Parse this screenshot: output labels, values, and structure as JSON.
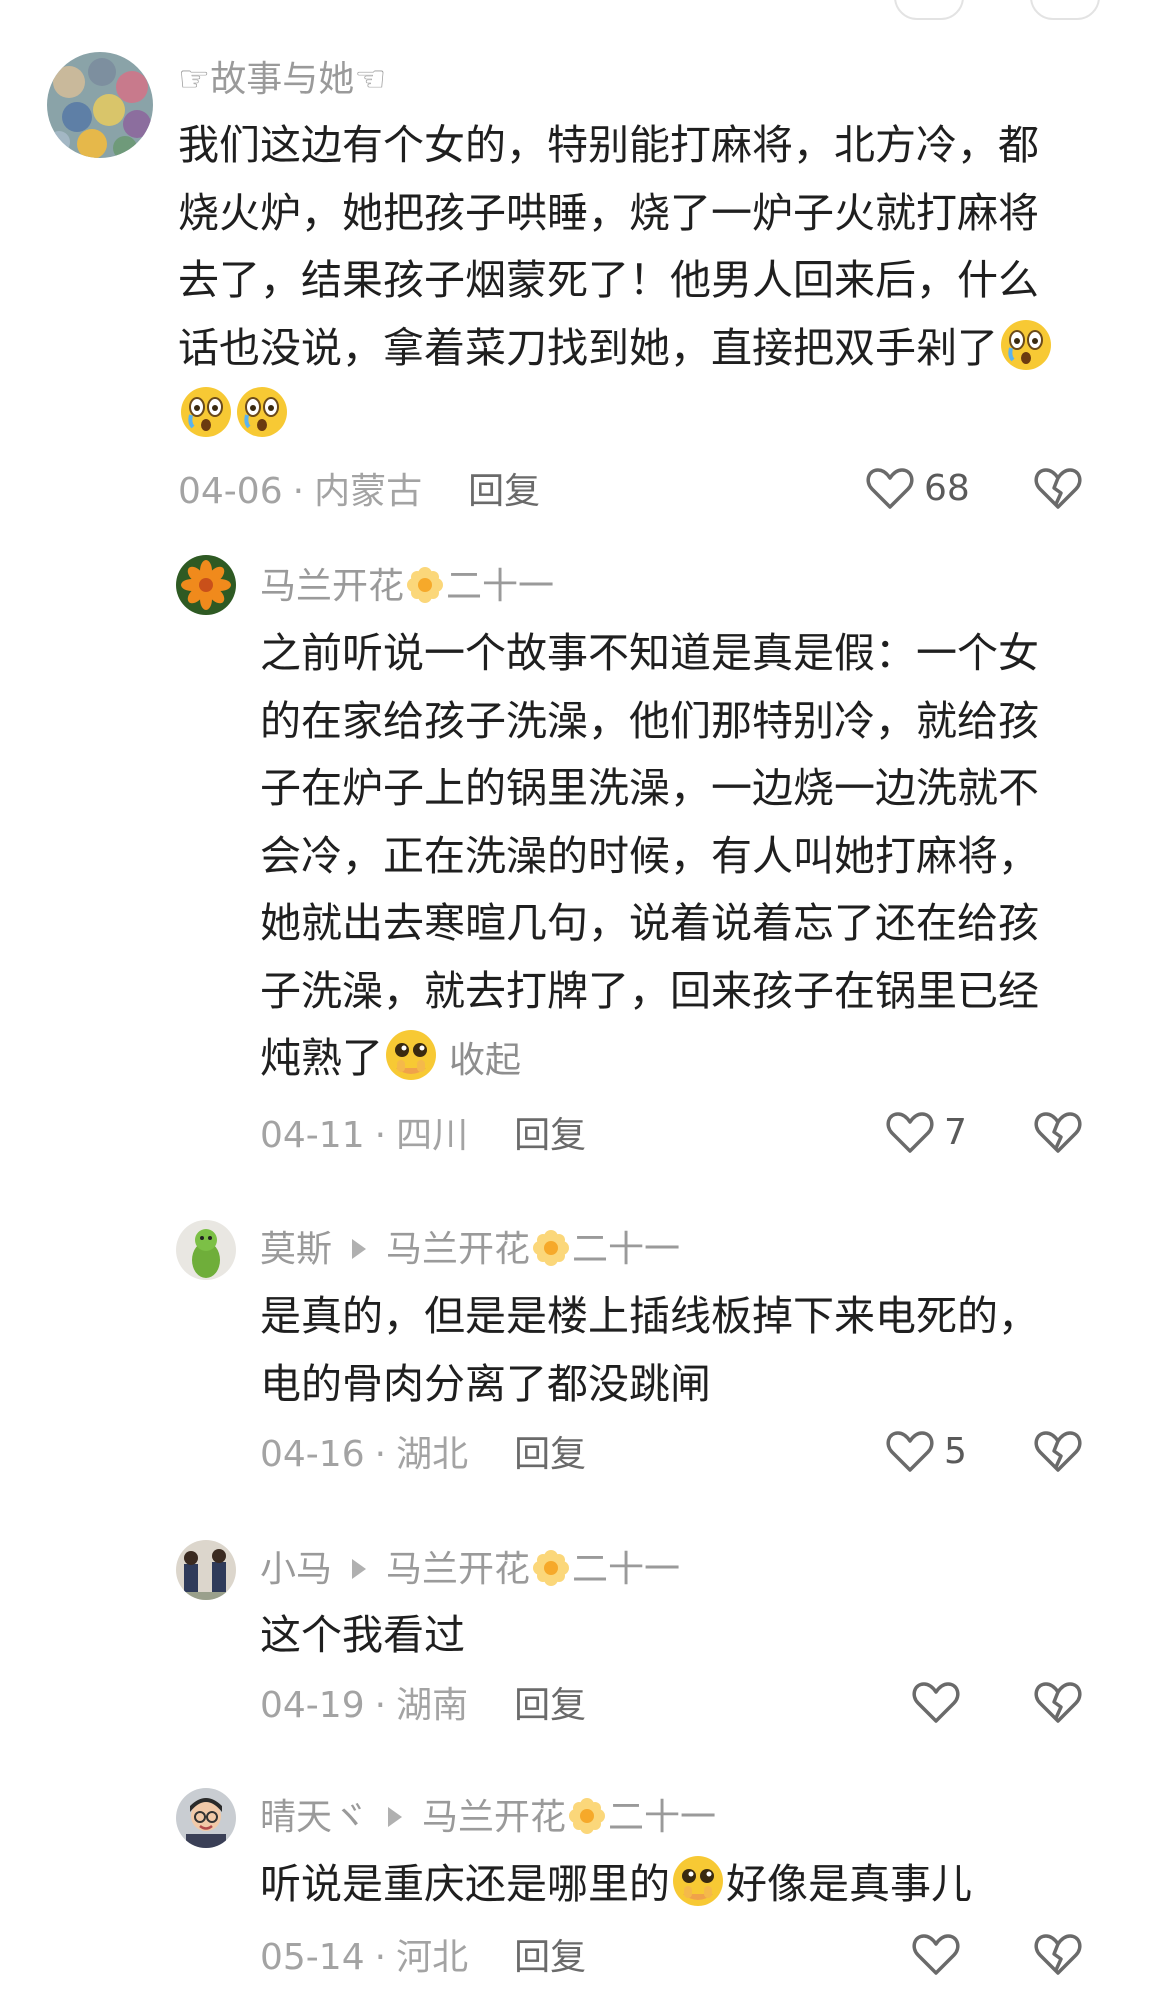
{
  "comments": [
    {
      "username": "☞故事与她☜",
      "text": "我们这边有个女的，特别能打麻将，北方冷，都烧火炉，她把孩子哄睡，烧了一炉子火就打麻将去了，结果孩子烟蒙死了！他男人回来后，什么话也没说，拿着菜刀找到她，直接把双手剁了",
      "date": "04-06",
      "location": "内蒙古",
      "reply_label": "回复",
      "likes": "68"
    },
    {
      "username": "马兰开花",
      "user_suffix": "二十一",
      "text": "之前听说一个故事不知道是真是假：一个女的在家给孩子洗澡，他们那特别冷，就给孩子在炉子上的锅里洗澡，一边烧一边洗就不会冷，正在洗澡的时候，有人叫她打麻将，她就出去寒暄几句，说着说着忘了还在给孩子洗澡，就去打牌了，回来孩子在锅里已经炖熟了",
      "collapse_label": "收起",
      "date": "04-11",
      "location": "四川",
      "reply_label": "回复",
      "likes": "7"
    },
    {
      "username": "莫斯",
      "reply_to": "马兰开花",
      "reply_to_suffix": "二十一",
      "text": "是真的，但是是楼上插线板掉下来电死的，电的骨肉分离了都没跳闸",
      "date": "04-16",
      "location": "湖北",
      "reply_label": "回复",
      "likes": "5"
    },
    {
      "username": "小马",
      "reply_to": "马兰开花",
      "reply_to_suffix": "二十一",
      "text": "这个我看过",
      "date": "04-19",
      "location": "湖南",
      "reply_label": "回复",
      "likes": ""
    },
    {
      "username": "晴天ヾ",
      "reply_to": "马兰开花",
      "reply_to_suffix": "二十一",
      "text_before_emoji": "听说是重庆还是哪里的",
      "text_after_emoji": "好像是真事儿",
      "date": "05-14",
      "location": "河北",
      "reply_label": "回复",
      "likes": ""
    }
  ],
  "meta_separator": "·",
  "icons": {
    "like": "heart-outline-icon",
    "dislike": "broken-heart-icon",
    "emoji_shocked": "shocked-emoji-icon",
    "emoji_pleading": "pleading-emoji-icon",
    "flower": "sunflower-badge-icon"
  },
  "colors": {
    "text": "#1f1f1f",
    "meta": "#a3a3a3",
    "username": "#9a9a9a",
    "icon": "#6a6a6a"
  }
}
